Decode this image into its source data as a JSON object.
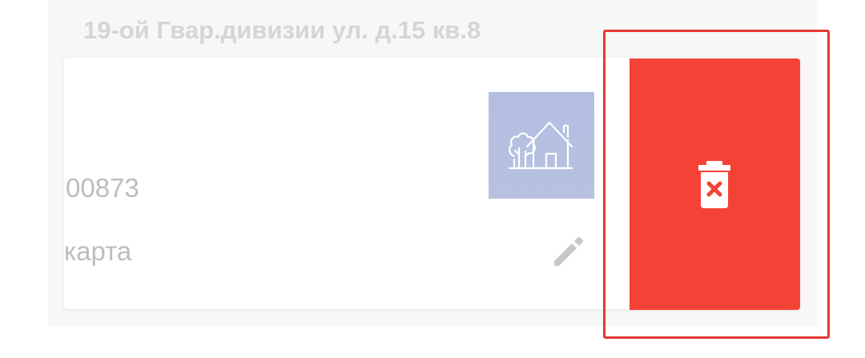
{
  "address": {
    "text": "19-ой Гвар.дивизии ул. д.15 кв.8"
  },
  "card": {
    "number": "00873",
    "type_label": "карта",
    "thumbnail_icon": "house-with-trees-icon",
    "edit_icon": "pencil-icon"
  },
  "delete_action": {
    "icon": "trash-x-icon",
    "color": "#f44336"
  },
  "highlight_color": "#e53935"
}
